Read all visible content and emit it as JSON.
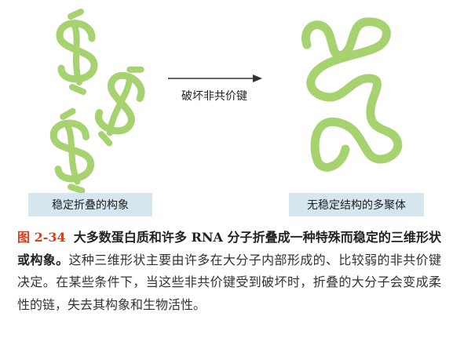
{
  "figure": {
    "stable_label": "稳定折叠的构象",
    "arrow_label": "破坏非共价键",
    "unstable_label": "无稳定结构的多聚体",
    "colors": {
      "strand": "#a6d26f",
      "label_bg": "#d5e6ee",
      "arrow": "#333333"
    }
  },
  "caption": {
    "number": "图 2-34",
    "title": "大多数蛋白质和许多 RNA 分子折叠成一种特殊而稳定的三维形状或构象。",
    "body": "这种三维形状主要由许多在大分子内部形成的、比较弱的非共价键决定。在某些条件下，当这些非共价键受到破坏时，折叠的大分子会变成柔性的链，失去其构象和生物活性。",
    "colors": {
      "number": "#d6401f"
    }
  }
}
